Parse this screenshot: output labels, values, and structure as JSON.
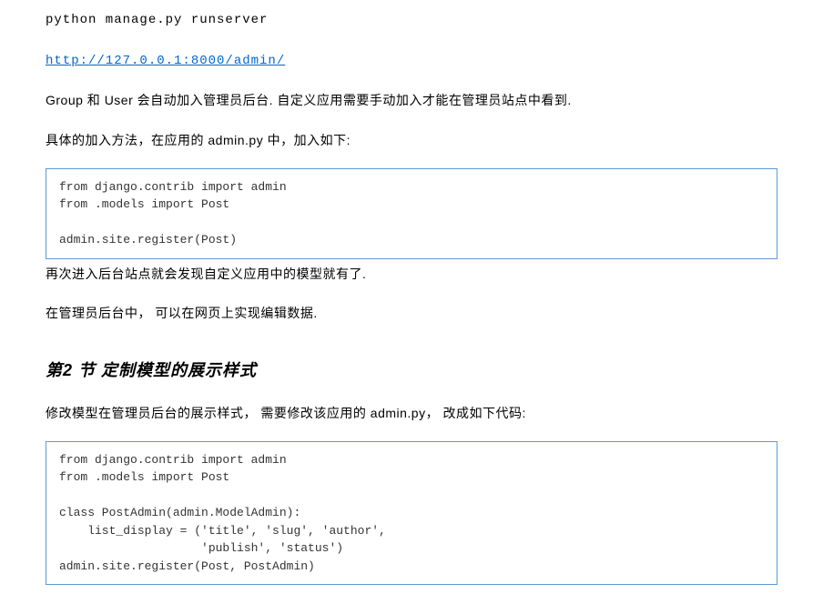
{
  "command": "python manage.py runserver",
  "url": "http://127.0.0.1:8000/admin/",
  "para1_pre": "Group 和 User 会自动加入管理员后台. 自定义应用需要手动加入才能在管理员站点中看到.",
  "para2": "具体的加入方法，在应用的 admin.py 中，加入如下:",
  "code1": "from django.contrib import admin\nfrom .models import Post\n\nadmin.site.register(Post)",
  "para3": "再次进入后台站点就会发现自定义应用中的模型就有了.",
  "para4": "在管理员后台中， 可以在网页上实现编辑数据.",
  "section2_title": "第2 节 定制模型的展示样式",
  "para5": "修改模型在管理员后台的展示样式， 需要修改该应用的 admin.py， 改成如下代码:",
  "code2": "from django.contrib import admin\nfrom .models import Post\n\nclass PostAdmin(admin.ModelAdmin):\n    list_display = ('title', 'slug', 'author',\n                    'publish', 'status')\nadmin.site.register(Post, PostAdmin)"
}
